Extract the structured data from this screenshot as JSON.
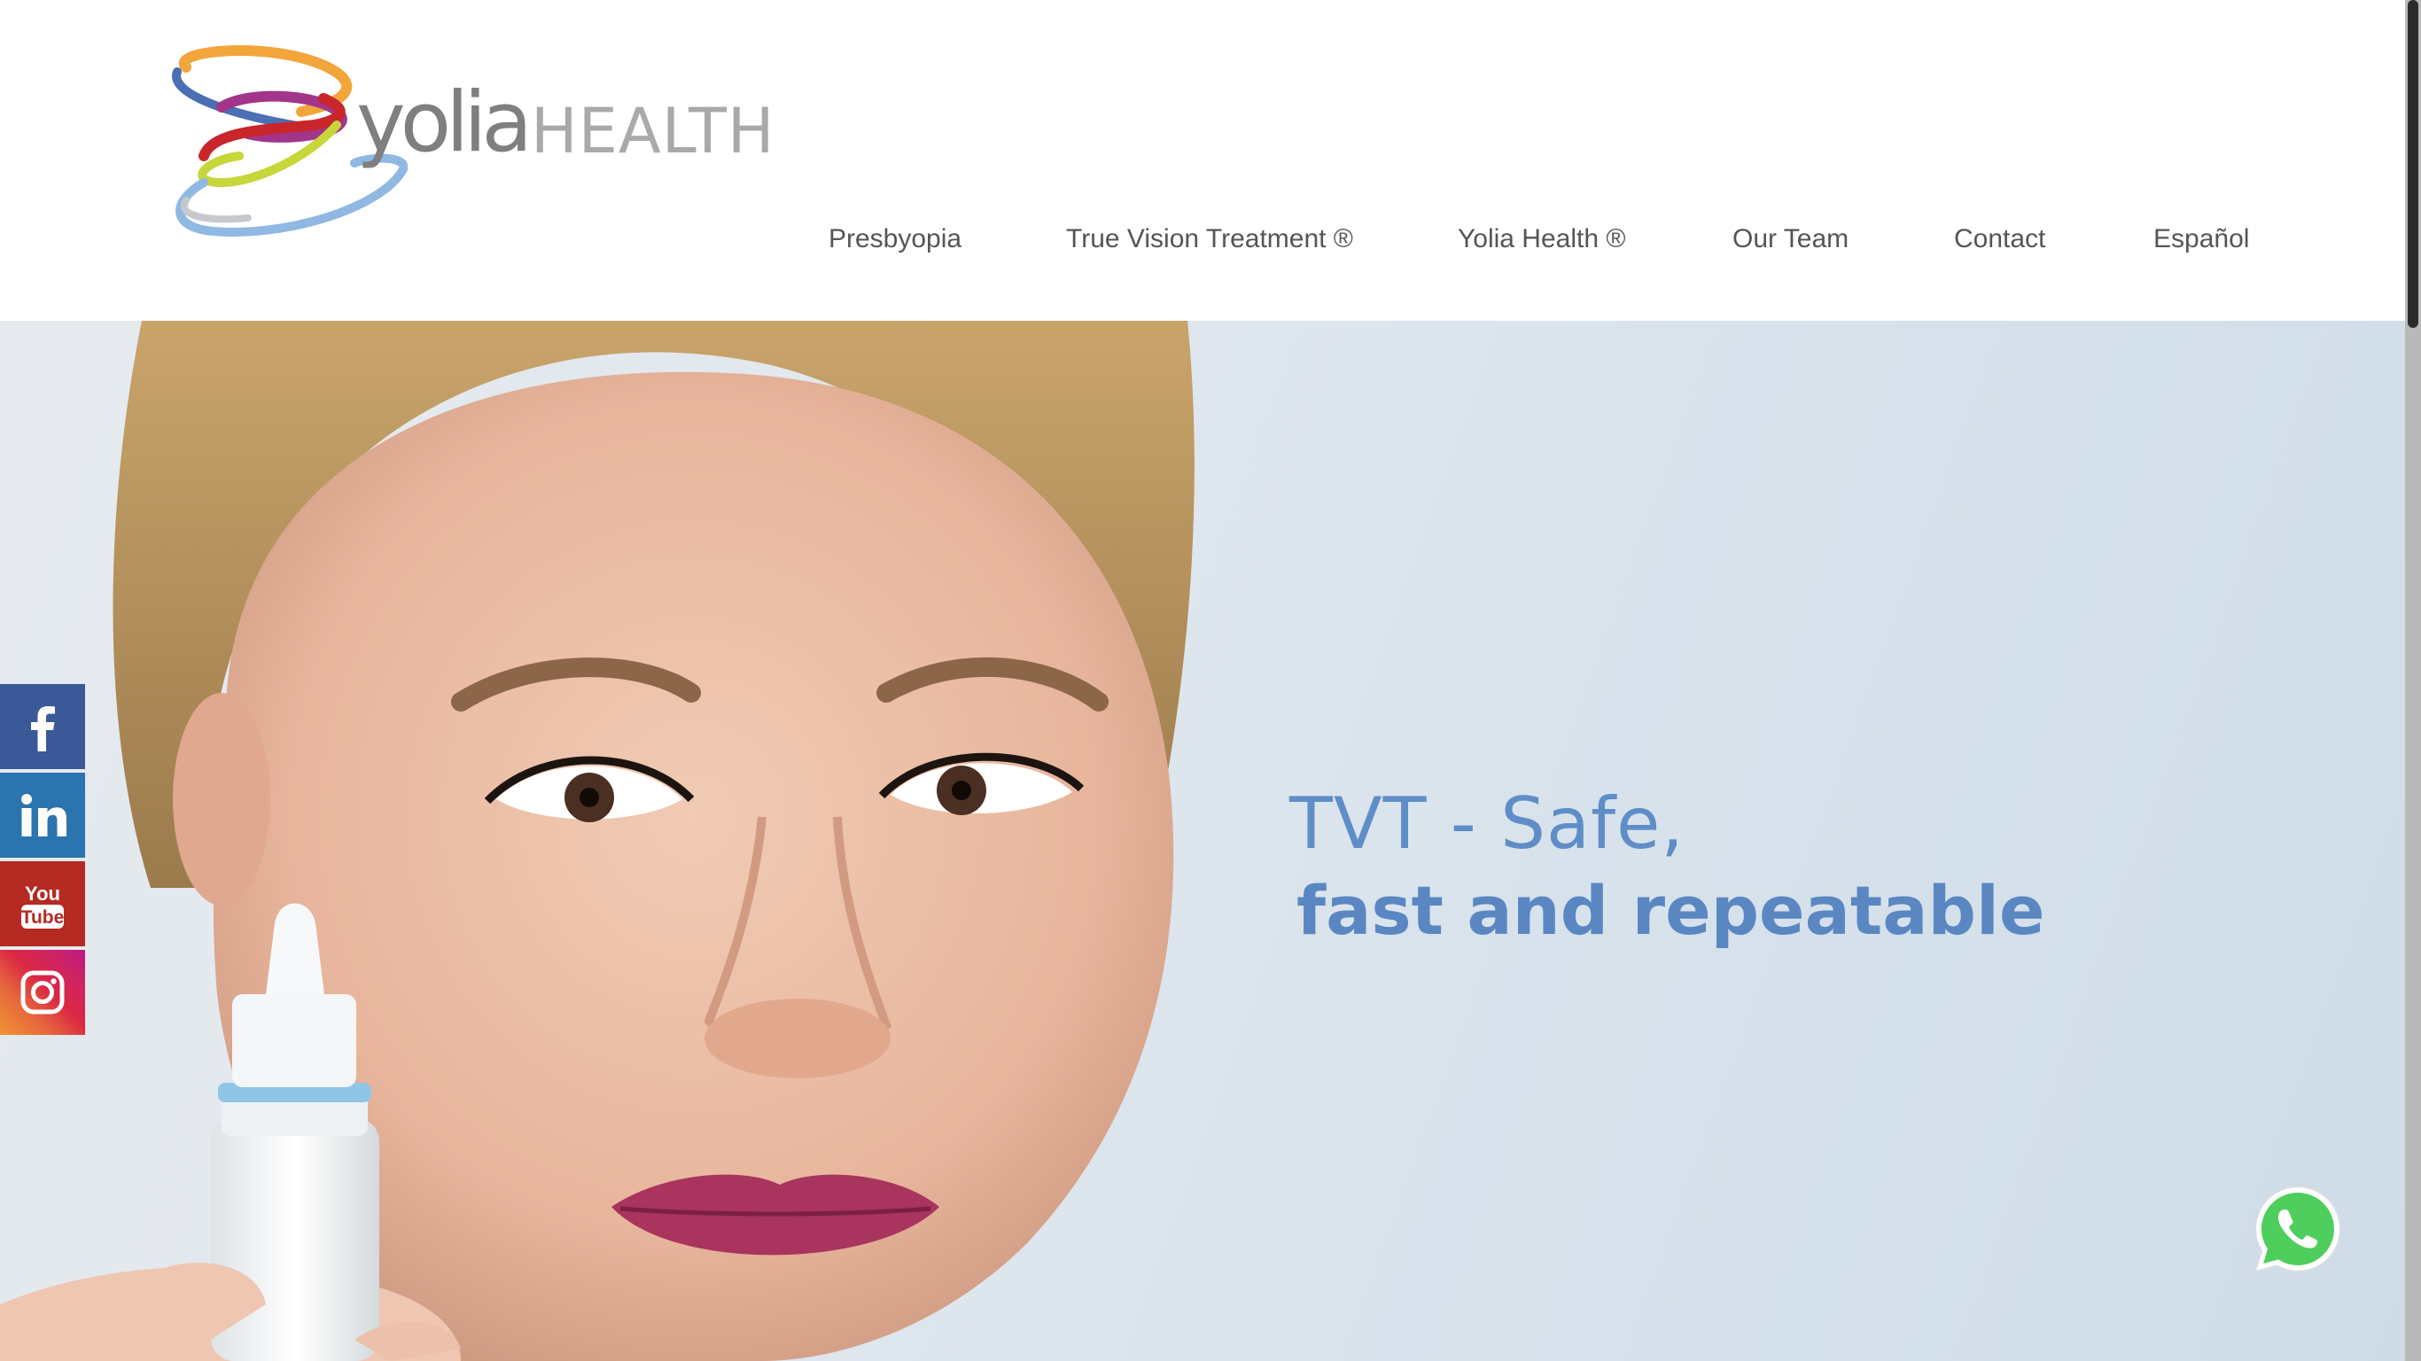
{
  "brand": {
    "name_part1": "yolia",
    "name_part2": "HEALTH",
    "logo_colors": [
      "#f2a53b",
      "#4b6fb5",
      "#a2358a",
      "#c9262b",
      "#c7d63a",
      "#8fb8e3"
    ]
  },
  "nav": {
    "items": [
      {
        "label": "Presbyopia"
      },
      {
        "label": "True Vision Treatment ®"
      },
      {
        "label": "Yolia Health ®"
      },
      {
        "label": "Our Team"
      },
      {
        "label": "Contact"
      },
      {
        "label": "Español"
      }
    ]
  },
  "hero": {
    "headline_line1": "TVT - Safe,",
    "headline_line2": "fast and repeatable",
    "headline_color": "#5f8dc7",
    "image": "woman-holding-eye-drop-bottle"
  },
  "social": [
    {
      "icon": "facebook-icon",
      "color": "#3b5998"
    },
    {
      "icon": "linkedin-icon",
      "color": "#2b74ad"
    },
    {
      "icon": "youtube-icon",
      "color": "#b52a22",
      "text_top": "You",
      "text_bottom": "Tube"
    },
    {
      "icon": "instagram-icon",
      "color": "#dc2743"
    }
  ],
  "whatsapp": {
    "icon": "whatsapp-icon",
    "color": "#4fce5d"
  }
}
